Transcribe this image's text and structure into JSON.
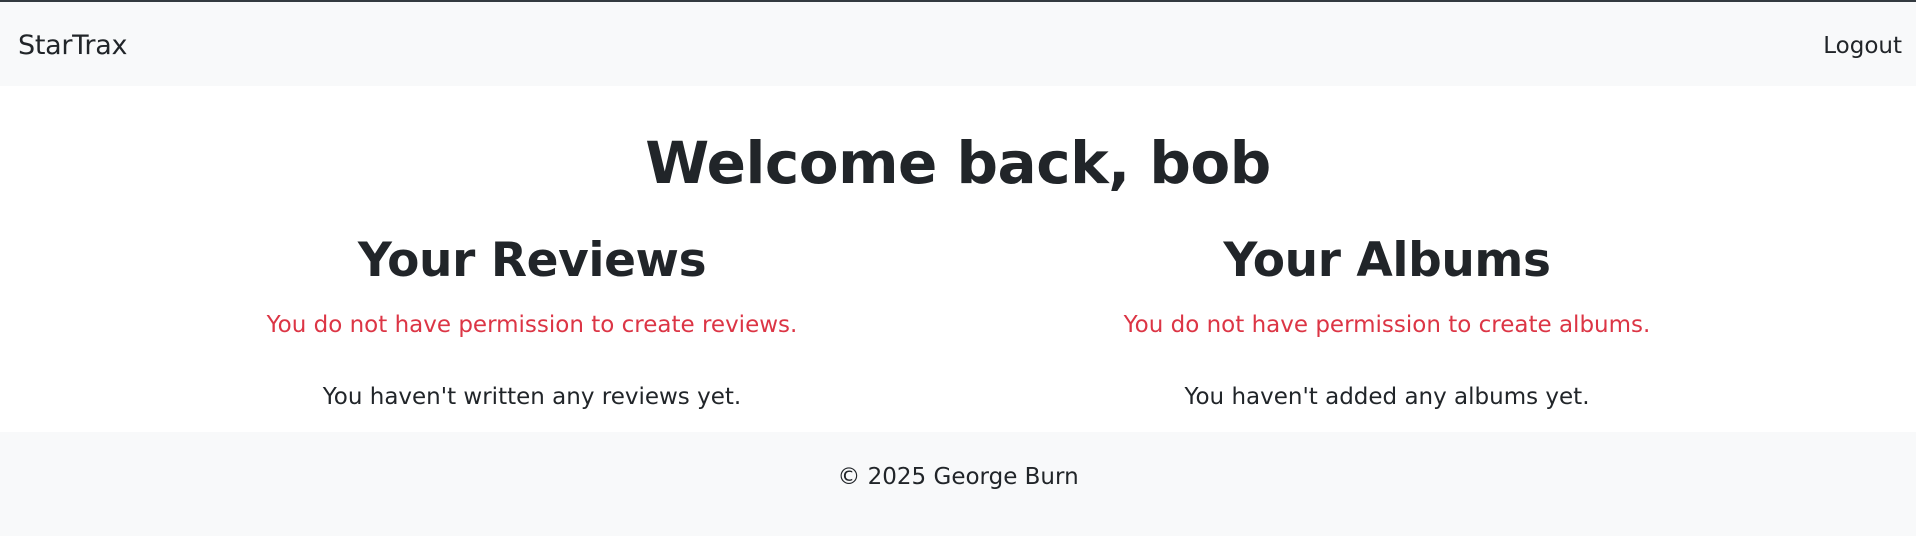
{
  "navbar": {
    "brand": "StarTrax",
    "logout_label": "Logout"
  },
  "main": {
    "welcome": "Welcome back, bob",
    "reviews": {
      "title": "Your Reviews",
      "permission_message": "You do not have permission to create reviews.",
      "empty_message": "You haven't written any reviews yet."
    },
    "albums": {
      "title": "Your Albums",
      "permission_message": "You do not have permission to create albums.",
      "empty_message": "You haven't added any albums yet."
    }
  },
  "footer": {
    "copyright": "© 2025 George Burn"
  },
  "colors": {
    "navbar_bg": "#f8f9fa",
    "text": "#212529",
    "danger": "#dc3545",
    "top_border": "#343a40"
  }
}
